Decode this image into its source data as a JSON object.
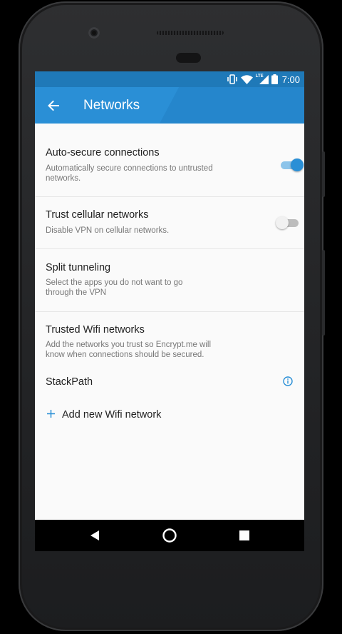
{
  "status_bar": {
    "time": "7:00",
    "network_type": "LTE",
    "icons": [
      "vibrate-icon",
      "wifi-icon",
      "cell-signal-icon",
      "battery-icon"
    ]
  },
  "app_bar": {
    "title": "Networks",
    "back_icon": "arrow-back-icon"
  },
  "settings": {
    "auto_secure": {
      "title": "Auto-secure connections",
      "summary": "Automatically secure connections to untrusted networks.",
      "enabled": true
    },
    "trust_cellular": {
      "title": "Trust cellular networks",
      "summary": "Disable VPN on cellular networks.",
      "enabled": false
    },
    "split_tunneling": {
      "title": "Split tunneling",
      "summary": "Select the apps you do not want to go through the VPN"
    },
    "trusted_wifi": {
      "title": "Trusted Wifi networks",
      "summary": "Add the networks you trust so Encrypt.me will know when connections should be secured.",
      "networks": [
        {
          "name": "StackPath",
          "icon": "info-icon"
        }
      ],
      "add_label": "Add new Wifi network",
      "add_icon": "plus-icon"
    }
  },
  "nav_bar": {
    "buttons": [
      "back-triangle-icon",
      "home-circle-icon",
      "recents-square-icon"
    ]
  },
  "colors": {
    "accent": "#2a8fd6",
    "status_bar": "#1f79b8",
    "app_bar": "#2a8fd6",
    "switch_track_on": "#8cc4ea"
  }
}
